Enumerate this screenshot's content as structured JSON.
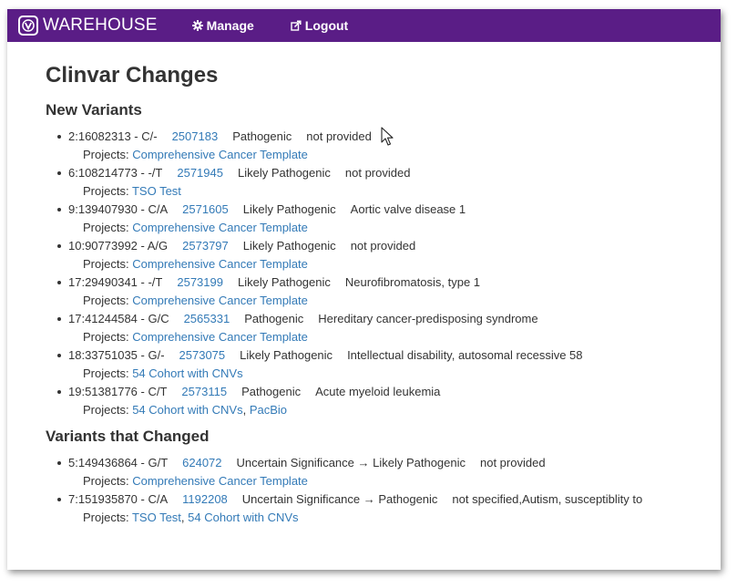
{
  "navbar": {
    "brand": "WAREHOUSE",
    "manage_label": "Manage",
    "logout_label": "Logout",
    "color": "#5a1d86"
  },
  "page": {
    "title": "Clinvar Changes",
    "projects_label": "Projects:",
    "sep": ",",
    "new_heading": "New Variants",
    "changed_heading": "Variants that Changed"
  },
  "new_variants": [
    {
      "variant": "2:16082313 - C/-",
      "clinvar_id": "2507183",
      "significance": "Pathogenic",
      "condition": "not provided",
      "projects": [
        "Comprehensive Cancer Template"
      ]
    },
    {
      "variant": "6:108214773 - -/T",
      "clinvar_id": "2571945",
      "significance": "Likely Pathogenic",
      "condition": "not provided",
      "projects": [
        "TSO Test"
      ]
    },
    {
      "variant": "9:139407930 - C/A",
      "clinvar_id": "2571605",
      "significance": "Likely Pathogenic",
      "condition": "Aortic valve disease 1",
      "projects": [
        "Comprehensive Cancer Template"
      ]
    },
    {
      "variant": "10:90773992 - A/G",
      "clinvar_id": "2573797",
      "significance": "Likely Pathogenic",
      "condition": "not provided",
      "projects": [
        "Comprehensive Cancer Template"
      ]
    },
    {
      "variant": "17:29490341 - -/T",
      "clinvar_id": "2573199",
      "significance": "Likely Pathogenic",
      "condition": "Neurofibromatosis, type 1",
      "projects": [
        "Comprehensive Cancer Template"
      ]
    },
    {
      "variant": "17:41244584 - G/C",
      "clinvar_id": "2565331",
      "significance": "Pathogenic",
      "condition": "Hereditary cancer-predisposing syndrome",
      "projects": [
        "Comprehensive Cancer Template"
      ]
    },
    {
      "variant": "18:33751035 - G/-",
      "clinvar_id": "2573075",
      "significance": "Likely Pathogenic",
      "condition": "Intellectual disability, autosomal recessive 58",
      "projects": [
        "54 Cohort with CNVs"
      ]
    },
    {
      "variant": "19:51381776 - C/T",
      "clinvar_id": "2573115",
      "significance": "Pathogenic",
      "condition": "Acute myeloid leukemia",
      "projects": [
        "54 Cohort with CNVs",
        "PacBio"
      ]
    }
  ],
  "changed_variants": [
    {
      "variant": "5:149436864 - G/T",
      "clinvar_id": "624072",
      "significance": "Uncertain Significance → Likely Pathogenic",
      "condition": "not provided",
      "projects": [
        "Comprehensive Cancer Template"
      ]
    },
    {
      "variant": "7:151935870 - C/A",
      "clinvar_id": "1192208",
      "significance": "Uncertain Significance → Pathogenic",
      "condition": "not specified,Autism, susceptiblity to",
      "projects": [
        "TSO Test",
        "54 Cohort with CNVs"
      ]
    }
  ],
  "colors": {
    "link": "#337ab7",
    "text": "#333333"
  }
}
